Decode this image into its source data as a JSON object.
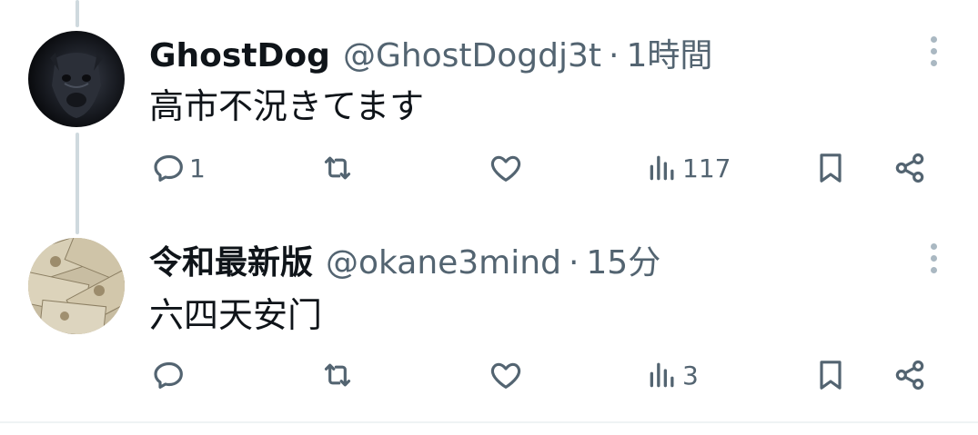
{
  "tweets": [
    {
      "name": "GhostDog",
      "handle": "@GhostDogdj3t",
      "separator": "·",
      "time": "1時間",
      "text": "高市不況きてます",
      "reply_count": "1",
      "view_count": "117",
      "avatar_icon": "dark-dog-avatar"
    },
    {
      "name": "令和最新版",
      "handle": "@okane3mind",
      "separator": "·",
      "time": "15分",
      "text": "六四天安门",
      "reply_count": "",
      "view_count": "3",
      "avatar_icon": "banknotes-avatar"
    }
  ],
  "icons": {
    "reply": "reply-icon",
    "retweet": "retweet-icon",
    "like": "heart-icon",
    "views": "views-icon",
    "bookmark": "bookmark-icon",
    "share": "share-icon",
    "more": "more-icon"
  },
  "colors": {
    "text": "#0f1419",
    "secondary": "#536471",
    "thread_line": "#cfd9de"
  }
}
